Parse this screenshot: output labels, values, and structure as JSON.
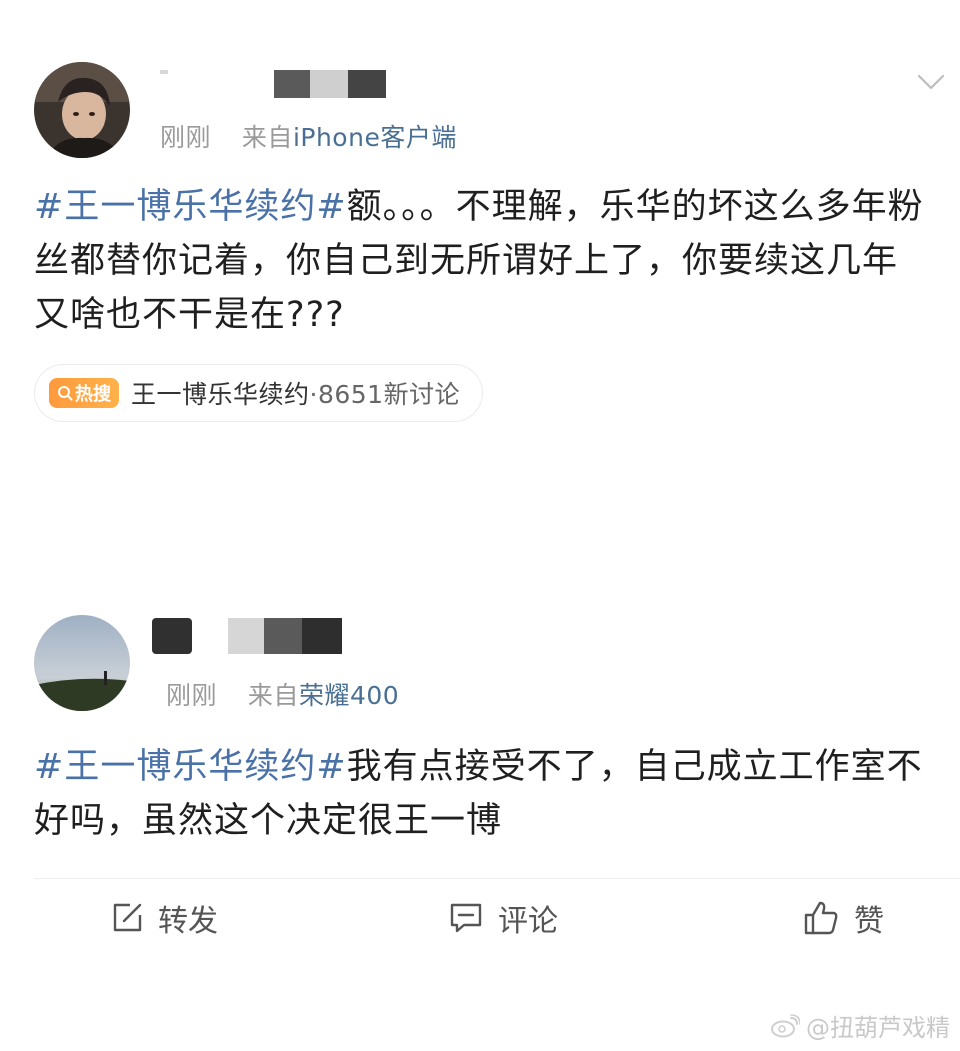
{
  "post1": {
    "name_redacted": true,
    "time": "刚刚",
    "source_prefix": "来自",
    "source": "iPhone客户端",
    "text_lines": [
      {
        "tag": "#王一博乐华续约#",
        "rest": "额。。。不理解，乐华的坏这么多年粉"
      },
      {
        "tag": "",
        "rest": "丝都替你记着，你自己到无所谓好上了，你要续这几年"
      },
      {
        "tag": "",
        "rest": "又啥也不干是在???"
      }
    ],
    "hot_search": {
      "badge": "热搜",
      "topic": "王一博乐华续约",
      "count": "·8651新讨论"
    }
  },
  "post2": {
    "name_redacted": true,
    "time": "刚刚",
    "source_prefix": "来自",
    "source": "荣耀400",
    "text_lines": [
      {
        "tag": "#王一博乐华续约#",
        "rest": "我有点接受不了，自己成立工作室不"
      },
      {
        "tag": "",
        "rest": "好吗，虽然这个决定很王一博"
      }
    ]
  },
  "actions": {
    "repost": "转发",
    "comment": "评论",
    "like": "赞"
  },
  "watermark": "@扭葫芦戏精",
  "icons": {
    "more": "chevron-down-icon",
    "repost": "repost-icon",
    "comment": "comment-icon",
    "like": "thumbs-up-icon",
    "hot": "search-icon",
    "watermark": "weibo-logo-icon"
  },
  "colors": {
    "hashtag": "#4a72a8",
    "meta": "#9a9a9a",
    "hot_badge": "#ff9f40"
  }
}
